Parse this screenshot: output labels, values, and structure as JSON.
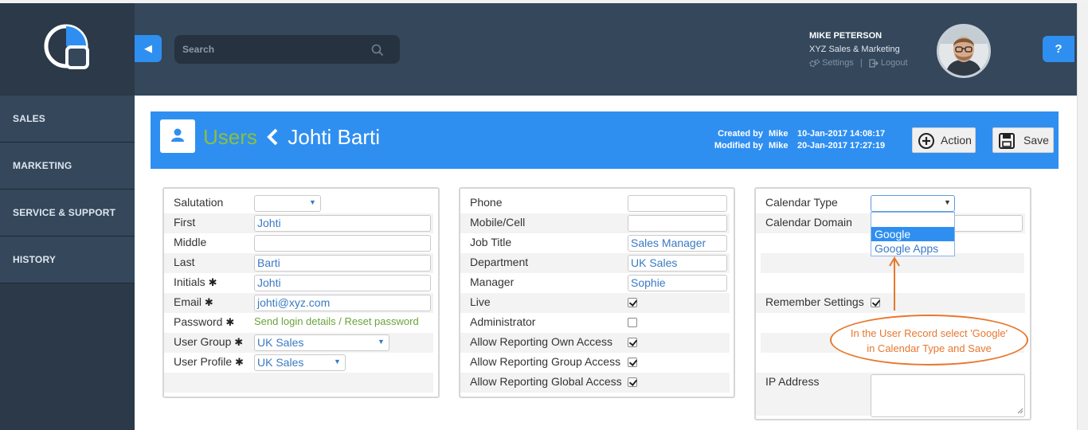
{
  "header": {
    "search_placeholder": "Search",
    "user_name": "MIKE PETERSON",
    "user_org": "XYZ Sales & Marketing",
    "settings_label": "Settings",
    "separator": "|",
    "logout_label": "Logout",
    "help_label": "?"
  },
  "sidebar": {
    "items": [
      {
        "label": "SALES"
      },
      {
        "label": "MARKETING"
      },
      {
        "label": "SERVICE & SUPPORT"
      },
      {
        "label": "HISTORY"
      }
    ]
  },
  "titlebar": {
    "section": "Users",
    "record_name": "Johti Barti",
    "created_label": "Created by",
    "created_by": "Mike",
    "created_at": "10-Jan-2017 14:08:17",
    "modified_label": "Modified by",
    "modified_by": "Mike",
    "modified_at": "20-Jan-2017 17:27:19",
    "action_label": "Action",
    "save_label": "Save"
  },
  "panel1": {
    "salutation_label": "Salutation",
    "salutation_value": "",
    "first_label": "First",
    "first_value": "Johti",
    "middle_label": "Middle",
    "middle_value": "",
    "last_label": "Last",
    "last_value": "Barti",
    "initials_label": "Initials",
    "initials_value": "Johti",
    "email_label": "Email",
    "email_value": "johti@xyz.com",
    "password_label": "Password",
    "password_link": "Send login details / Reset password",
    "group_label": "User Group",
    "group_value": "UK Sales",
    "profile_label": "User Profile",
    "profile_value": "UK Sales",
    "required_mark": "✱"
  },
  "panel2": {
    "phone_label": "Phone",
    "phone_value": "",
    "mobile_label": "Mobile/Cell",
    "mobile_value": "",
    "jobtitle_label": "Job Title",
    "jobtitle_value": "Sales Manager",
    "department_label": "Department",
    "department_value": "UK Sales",
    "manager_label": "Manager",
    "manager_value": "Sophie",
    "live_label": "Live",
    "admin_label": "Administrator",
    "own_label": "Allow Reporting Own Access",
    "group_access_label": "Allow Reporting Group Access",
    "global_label": "Allow Reporting Global Access"
  },
  "panel3": {
    "caltype_label": "Calendar Type",
    "caltype_value": "",
    "caldomain_label": "Calendar Domain",
    "caldomain_value": "",
    "remember_label": "Remember Settings",
    "ip_label": "IP Address",
    "ip_value": "",
    "dropdown_options": [
      "Google",
      "Google Apps"
    ]
  },
  "callout": {
    "line1": "In the User Record select 'Google'",
    "line2": "in Calendar Type and Save"
  },
  "checkbox_states": {
    "live": true,
    "administrator": false,
    "own_access": true,
    "group_access": true,
    "global_access": true,
    "remember_settings": true
  },
  "colors": {
    "sidebar": "#2b3948",
    "header": "#34475b",
    "accent_blue": "#2f8ff0",
    "breadcrumb_green": "#8bbf3f",
    "callout_orange": "#e8772e"
  }
}
